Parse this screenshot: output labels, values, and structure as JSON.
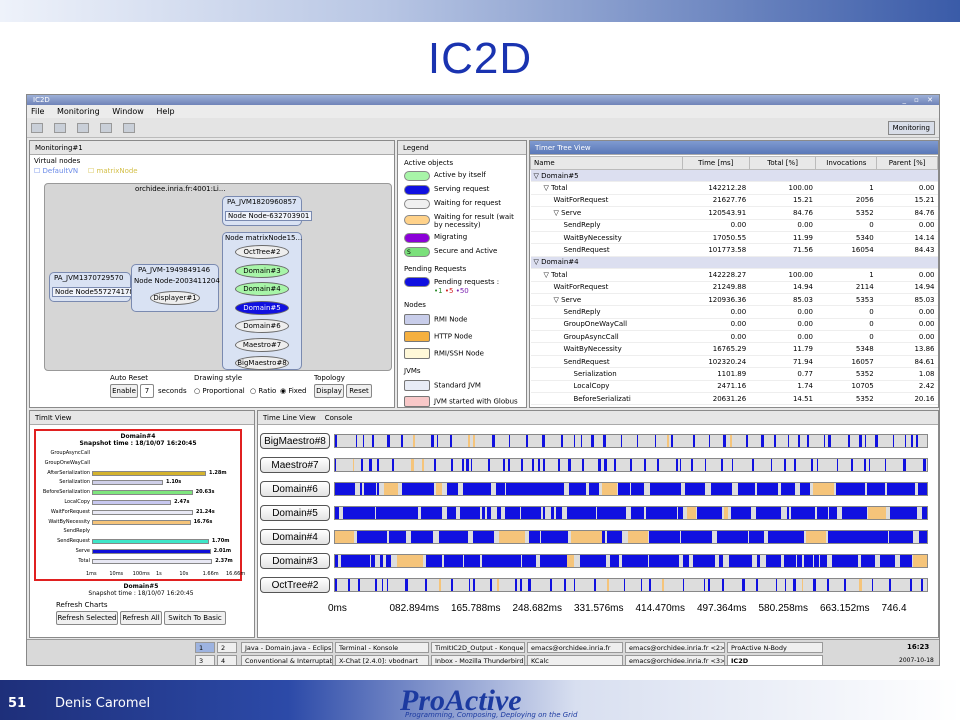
{
  "slide": {
    "title": "IC2D",
    "number": "51",
    "author": "Denis Caromel",
    "logo": "ProActive",
    "tagline": "Programming, Composing, Deploying on the Grid"
  },
  "window": {
    "title": "IC2D"
  },
  "menu": [
    "File",
    "Monitoring",
    "Window",
    "Help"
  ],
  "perspective": "Monitoring",
  "monitoring": {
    "tab": "Monitoring#1",
    "virtual_nodes_label": "Virtual nodes",
    "vn1": "DefaultVN",
    "vn2": "matrixNode",
    "host": "orchidee.inria.fr:4001:Li...",
    "jvm1": "PA_JVM1820960857",
    "node1": "Node Node-632703901",
    "jvm2": "PA_JVM1370729570",
    "node2": "Node Node557274178",
    "jvm3": "PA_JVM-1949849146",
    "node3": "Node Node-2003411204",
    "obj3": "Displayer#1",
    "node4": "Node matrixNode15...",
    "objects": [
      "OctTree#2",
      "Domain#3",
      "Domain#4",
      "Domain#5",
      "Domain#6",
      "Maestro#7",
      "BigMaestro#8"
    ],
    "auto_reset": "Auto Reset",
    "enable": "Enable",
    "seconds_value": "7",
    "seconds": "seconds",
    "drawing_style": "Drawing style",
    "proportional": "Proportional",
    "ratio": "Ratio",
    "fixed": "Fixed",
    "topology": "Topology",
    "display": "Display",
    "reset": "Reset"
  },
  "legend": {
    "tab": "Legend",
    "active_objects": "Active objects",
    "items": [
      "Active by itself",
      "Serving request",
      "Waiting for request",
      "Waiting for result (wait by necessity)",
      "Migrating",
      "Secure and Active"
    ],
    "secure_mark": "S",
    "pending": "Pending Requests",
    "pending_label": "Pending requests :",
    "pending_vals": [
      "1",
      "5",
      "50"
    ],
    "nodes": "Nodes",
    "node_items": [
      "RMI Node",
      "HTTP Node",
      "RMI/SSH Node"
    ],
    "jvms": "JVMs",
    "jvm_items": [
      "Standard JVM",
      "JVM started with Globus"
    ],
    "colors": {
      "active": "#a8f5a8",
      "serving": "#1010e0",
      "waiting": "#f0f0f0",
      "waitres": "#ffd28a",
      "migrating": "#8b00d8",
      "secure": "#7be07b"
    }
  },
  "timer": {
    "tab": "Timer Tree View",
    "headers": [
      "Name",
      "Time [ms]",
      "Total [%]",
      "Invocations",
      "Parent [%]"
    ],
    "rows": [
      {
        "name": "Domain#5",
        "indent": 0,
        "grp": true,
        "t": "",
        "tot": "",
        "inv": "",
        "par": ""
      },
      {
        "name": "Total",
        "indent": 1,
        "t": "142212.28",
        "tot": "100.00",
        "inv": "1",
        "par": "0.00"
      },
      {
        "name": "WaitForRequest",
        "indent": 2,
        "t": "21627.76",
        "tot": "15.21",
        "inv": "2056",
        "par": "15.21"
      },
      {
        "name": "Serve",
        "indent": 2,
        "t": "120543.91",
        "tot": "84.76",
        "inv": "5352",
        "par": "84.76"
      },
      {
        "name": "SendReply",
        "indent": 3,
        "t": "0.00",
        "tot": "0.00",
        "inv": "0",
        "par": "0.00"
      },
      {
        "name": "WaitByNecessity",
        "indent": 3,
        "t": "17050.55",
        "tot": "11.99",
        "inv": "5340",
        "par": "14.14"
      },
      {
        "name": "SendRequest",
        "indent": 3,
        "t": "101773.58",
        "tot": "71.56",
        "inv": "16054",
        "par": "84.43"
      },
      {
        "name": "Domain#4",
        "indent": 0,
        "grp": true,
        "t": "",
        "tot": "",
        "inv": "",
        "par": ""
      },
      {
        "name": "Total",
        "indent": 1,
        "t": "142228.27",
        "tot": "100.00",
        "inv": "1",
        "par": "0.00"
      },
      {
        "name": "WaitForRequest",
        "indent": 2,
        "t": "21249.88",
        "tot": "14.94",
        "inv": "2114",
        "par": "14.94"
      },
      {
        "name": "Serve",
        "indent": 2,
        "t": "120936.36",
        "tot": "85.03",
        "inv": "5353",
        "par": "85.03"
      },
      {
        "name": "SendReply",
        "indent": 3,
        "t": "0.00",
        "tot": "0.00",
        "inv": "0",
        "par": "0.00"
      },
      {
        "name": "GroupOneWayCall",
        "indent": 3,
        "t": "0.00",
        "tot": "0.00",
        "inv": "0",
        "par": "0.00"
      },
      {
        "name": "GroupAsyncCall",
        "indent": 3,
        "t": "0.00",
        "tot": "0.00",
        "inv": "0",
        "par": "0.00"
      },
      {
        "name": "WaitByNecessity",
        "indent": 3,
        "t": "16765.29",
        "tot": "11.79",
        "inv": "5348",
        "par": "13.86"
      },
      {
        "name": "SendRequest",
        "indent": 3,
        "t": "102320.24",
        "tot": "71.94",
        "inv": "16057",
        "par": "84.61"
      },
      {
        "name": "Serialization",
        "indent": 4,
        "t": "1101.89",
        "tot": "0.77",
        "inv": "5352",
        "par": "1.08"
      },
      {
        "name": "LocalCopy",
        "indent": 4,
        "t": "2471.16",
        "tot": "1.74",
        "inv": "10705",
        "par": "2.42"
      },
      {
        "name": "BeforeSerializati",
        "indent": 4,
        "t": "20631.26",
        "tot": "14.51",
        "inv": "5352",
        "par": "20.16"
      }
    ]
  },
  "timit": {
    "tab": "TimIt View",
    "chart_title": "Domain#4",
    "snapshot": "Snapshot time : 18/10/07 16:20:45",
    "bars": [
      {
        "label": "GroupAsyncCall",
        "value": null,
        "text": "",
        "color": "#888888"
      },
      {
        "label": "GroupOneWayCall",
        "value": null,
        "text": "",
        "color": "#888888"
      },
      {
        "label": "AfterSerialization",
        "value": 1280,
        "text": "1.28m",
        "color": "#d4b32e"
      },
      {
        "label": "Serialization",
        "value": 1.1,
        "text": "1.10s",
        "color": "#cfcfe8"
      },
      {
        "label": "BeforeSerialization",
        "value": 20.63,
        "text": "20.63s",
        "color": "#7ee67e"
      },
      {
        "label": "LocalCopy",
        "value": 2.47,
        "text": "2.47s",
        "color": "#c8c8f0"
      },
      {
        "label": "WaitForRequest",
        "value": 21.24,
        "text": "21.24s",
        "color": "#e8e8f4"
      },
      {
        "label": "WaitByNecessity",
        "value": 16.76,
        "text": "16.76s",
        "color": "#f5c47a"
      },
      {
        "label": "SendReply",
        "value": null,
        "text": "",
        "color": "#888888"
      },
      {
        "label": "SendRequest",
        "value": 1700,
        "text": "1.70m",
        "color": "#3ee6c8"
      },
      {
        "label": "Serve",
        "value": 2010,
        "text": "2.01m",
        "color": "#1010d8"
      },
      {
        "label": "Total",
        "value": 2370,
        "text": "2.37m",
        "color": "#e8e8f4"
      }
    ],
    "axis": [
      "1ms",
      "10ms",
      "100ms",
      "1s",
      "10s",
      "1.66m",
      "16.66m"
    ],
    "next_title": "Domain#5",
    "next_snapshot": "Snapshot time : 18/10/07 16:20:45",
    "refresh": "Refresh Charts",
    "refresh_selected": "Refresh Selected",
    "refresh_all": "Refresh All",
    "switch_basic": "Switch To Basic"
  },
  "timeline": {
    "tab": "Time Line View",
    "tab2": "Console",
    "rows": [
      "BigMaestro#8",
      "Maestro#7",
      "Domain#6",
      "Domain#5",
      "Domain#4",
      "Domain#3",
      "OctTree#2"
    ],
    "axis": [
      "0ms",
      "082.894ms",
      "165.788ms",
      "248.682ms",
      "331.576ms",
      "414.470ms",
      "497.364ms",
      "580.258ms",
      "663.152ms",
      "746.4"
    ]
  },
  "taskbar": {
    "desktops": [
      "1",
      "2",
      "3",
      "4"
    ],
    "items_top": [
      "Java - Domain.java - Eclips",
      "Terminal - Konsole",
      "TimItIC2D_Output - Konque",
      "emacs@orchidee.inria.fr",
      "emacs@orchidee.inria.fr <2>",
      "ProActive N-Body"
    ],
    "items_bottom": [
      "Conventional & Interruptabl",
      "X-Chat [2.4.0]: vbodnart",
      "Inbox - Mozilla Thunderbird",
      "KCalc",
      "emacs@orchidee.inria.fr <3>",
      "IC2D"
    ],
    "clock": "16:23",
    "date": "2007-10-18"
  }
}
